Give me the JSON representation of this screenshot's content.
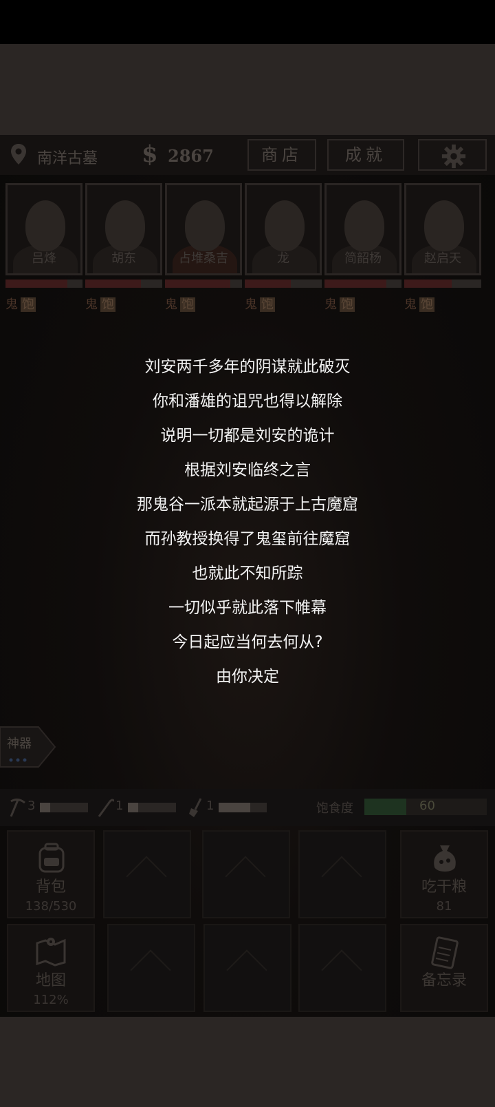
{
  "header": {
    "location": "南洋古墓",
    "currency_symbol": "$",
    "money": "2867",
    "shop_label": "商店",
    "achievement_label": "成就",
    "settings_icon": "gear-icon"
  },
  "characters": [
    {
      "name": "吕烽",
      "health": 0.8,
      "tag1": "鬼",
      "tag2": "饱"
    },
    {
      "name": "胡东",
      "health": 0.72,
      "tag1": "鬼",
      "tag2": "饱"
    },
    {
      "name": "占堆桑吉",
      "health": 0.85,
      "tag1": "鬼",
      "tag2": "饱"
    },
    {
      "name": "龙",
      "health": 0.6,
      "tag1": "鬼",
      "tag2": "饱"
    },
    {
      "name": "简韶杨",
      "health": 0.8,
      "tag1": "鬼",
      "tag2": "饱"
    },
    {
      "name": "赵启天",
      "health": 0.62,
      "tag1": "鬼",
      "tag2": "饱"
    }
  ],
  "story": {
    "lines": [
      "刘安两千多年的阴谋就此破灭",
      "你和潘雄的诅咒也得以解除",
      "说明一切都是刘安的诡计",
      "根据刘安临终之言",
      "那鬼谷一派本就起源于上古魔窟",
      "而孙教授换得了鬼玺前往魔窟",
      "也就此不知所踪",
      "一切似乎就此落下帷幕",
      "今日起应当何去何从?",
      "由你决定"
    ]
  },
  "artifact_tab": {
    "label": "神器"
  },
  "stats": {
    "tools": [
      {
        "icon": "pickaxe-icon",
        "count": "3"
      },
      {
        "icon": "crowbar-icon",
        "count": "1"
      },
      {
        "icon": "shovel-icon",
        "count": "1"
      }
    ],
    "satiety_label": "饱食度",
    "satiety_value": "60",
    "satiety_fraction": 0.34
  },
  "grid": {
    "backpack": {
      "label": "背包",
      "value": "138/530",
      "icon": "backpack-icon"
    },
    "eat": {
      "label": "吃干粮",
      "value": "81",
      "icon": "food-bag-icon"
    },
    "map": {
      "label": "地图",
      "value": "112%",
      "icon": "map-icon"
    },
    "memo": {
      "label": "备忘录",
      "icon": "memo-icon"
    }
  }
}
